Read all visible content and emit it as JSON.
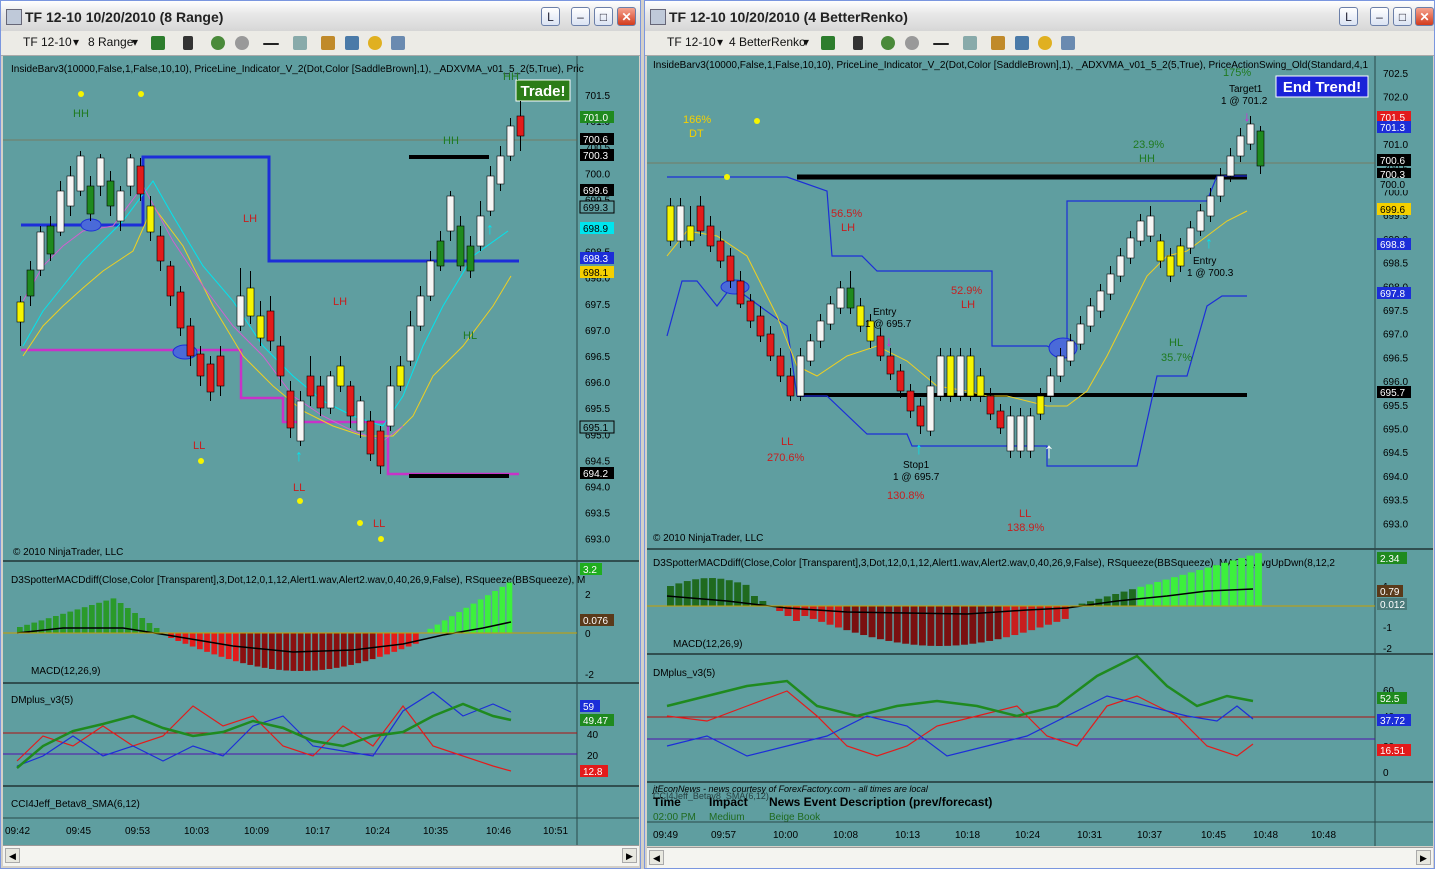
{
  "left": {
    "title": "TF 12-10  10/20/2010 (8 Range)",
    "instrument": "TF 12-10",
    "period": "8 Range",
    "indicator_line": "InsideBarv3(10000,False,1,False,10,10),  PriceLine_Indicator_V_2(Dot,Color [SaddleBrown],1),  _ADXVMA_v01_5_2(5,True),  Pric",
    "copyright": "© 2010 NinjaTrader, LLC",
    "trade_button": "Trade!",
    "price_labels": [
      "701.5",
      "701.0",
      "700.5",
      "700.0",
      "699.5",
      "699.0",
      "698.5",
      "698.0",
      "697.5",
      "697.0",
      "696.5",
      "696.0",
      "695.5",
      "695.0",
      "694.5",
      "694.0",
      "693.5",
      "693.0"
    ],
    "highlighted_prices": [
      "701.0",
      "700.6",
      "700.3",
      "699.6",
      "699.3",
      "698.9",
      "698.3",
      "698.1",
      "695.1",
      "694.2"
    ],
    "annotations": [
      "HH",
      "HH",
      "HH",
      "LH",
      "LH",
      "HL",
      "LL",
      "LL",
      "LL"
    ],
    "macd_title": "D3SpotterMACDdiff(Close,Color [Transparent],3,Dot,12,0,1,12,Alert1.wav,Alert2.wav,0,40,26,9,False), RSqueeze(BBSqueeze), M",
    "macd_label": "MACD(12,26,9)",
    "macd_scale": [
      "2",
      "0",
      "-2"
    ],
    "macd_badges": [
      "3.2",
      "0.076"
    ],
    "dmplus_title": "DMplus_v3(5)",
    "dmplus_scale": [
      "40",
      "20"
    ],
    "dmplus_badges": [
      "59",
      "49.47",
      "12.8"
    ],
    "cci_title": "CCI4Jeff_Betav8_SMA(6,12)",
    "times": [
      "09:42",
      "09:45",
      "09:53",
      "10:03",
      "10:09",
      "10:17",
      "10:24",
      "10:35",
      "10:46",
      "10:51"
    ]
  },
  "right": {
    "title": "TF 12-10  10/20/2010 (4 BetterRenko)",
    "instrument": "TF 12-10",
    "period": "4 BetterRenko",
    "indicator_line": "InsideBarv3(10000,False,1,False,10,10),  PriceLine_Indicator_V_2(Dot,Color [SaddleBrown],1),  _ADXVMA_v01_5_2(5,True),  PriceActionSwing_Old(Standard,4,1",
    "copyright": "© 2010 NinjaTrader, LLC",
    "end_trend_button": "End Trend!",
    "price_labels": [
      "702.5",
      "702.0",
      "701.5",
      "701.0",
      "700.5",
      "700.0",
      "699.5",
      "699.0",
      "698.5",
      "698.0",
      "697.5",
      "697.0",
      "696.5",
      "696.0",
      "695.5",
      "695.0",
      "694.5",
      "694.0",
      "693.5",
      "693.0"
    ],
    "highlighted_prices": [
      "701.5",
      "701.3",
      "700.6",
      "700.3",
      "700.0",
      "699.6",
      "698.8",
      "697.8",
      "695.7"
    ],
    "annotations": [
      "166%",
      "DT",
      "56.5%",
      "LH",
      "52.9%",
      "LH",
      "LL",
      "270.6%",
      "LL",
      "138.9%",
      "130.8%",
      "HL",
      "35.7%",
      "HH",
      "23.9%",
      "175%"
    ],
    "entry1": "Entry",
    "entry1_price": "1 @ 695.7",
    "stop1": "Stop1",
    "stop1_price": "1 @ 695.7",
    "entry2": "Entry",
    "entry2_price": "1 @ 700.3",
    "target1": "Target1",
    "target1_price": "1 @ 701.2",
    "macd_title": "D3SpotterMACDdiff(Close,Color [Transparent],3,Dot,12,0,1,12,Alert1.wav,Alert2.wav,0,40,26,9,False), RSqueeze(BBSqueeze), MACD_AvgUpDwn(8,12,2",
    "macd_label": "MACD(12,26,9)",
    "macd_scale": [
      "1",
      "0",
      "-1",
      "-2"
    ],
    "macd_badges": [
      "2.34",
      "0.79",
      "0.012"
    ],
    "dmplus_title": "DMplus_v3(5)",
    "dmplus_scale": [
      "60",
      "40",
      "20",
      "0"
    ],
    "dmplus_badges": [
      "52.5",
      "37.72",
      "16.51"
    ],
    "news_title": "jtEconNews - news courtesy of ForexFactory.com - all times are local",
    "news_headers": [
      "Time",
      "Impact",
      "News Event Description (prev/forecast)"
    ],
    "news_row": [
      "02:00 PM",
      "Medium",
      "Beige Book"
    ],
    "cci_title": "CCI4Jeff_Betav8_SMA(6,12)",
    "times": [
      "09:49",
      "09:57",
      "10:00",
      "10:08",
      "10:13",
      "10:18",
      "10:24",
      "10:31",
      "10:37",
      "10:45",
      "10:48",
      "10:48"
    ]
  },
  "colors": {
    "chart_bg": "#5f9ea0",
    "up": "#f5f5f5",
    "down": "#e31b1b",
    "yellow": "#f5f500",
    "green": "#1f8a1f",
    "blue": "#1c2ed8",
    "magenta": "#c832c8"
  }
}
